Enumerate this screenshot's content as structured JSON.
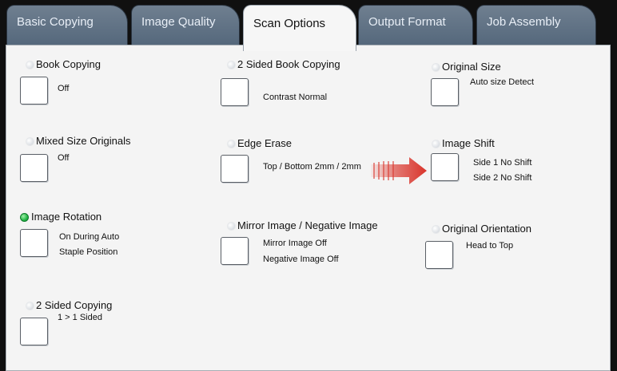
{
  "tabs": [
    {
      "label": "Basic Copying",
      "active": false
    },
    {
      "label": "Image Quality",
      "active": false
    },
    {
      "label": "Scan Options",
      "active": true
    },
    {
      "label": "Output Format",
      "active": false
    },
    {
      "label": "Job Assembly",
      "active": false
    }
  ],
  "options": {
    "book_copying": {
      "title": "Book Copying",
      "values": [
        "Off"
      ],
      "selected": false
    },
    "two_sided_book_copying": {
      "title": "2 Sided Book Copying",
      "values": [
        "Contrast Normal"
      ],
      "selected": false
    },
    "original_size": {
      "title": "Original Size",
      "values": [
        "Auto size Detect"
      ],
      "selected": false
    },
    "mixed_size_originals": {
      "title": "Mixed Size Originals",
      "values": [
        "Off"
      ],
      "selected": false
    },
    "edge_erase": {
      "title": "Edge Erase",
      "values": [
        "Top / Bottom 2mm / 2mm"
      ],
      "selected": false
    },
    "image_shift": {
      "title": "Image Shift",
      "values": [
        "Side 1 No Shift",
        "Side 2 No Shift"
      ],
      "selected": false
    },
    "image_rotation": {
      "title": "Image Rotation",
      "values": [
        "On During Auto",
        "Staple Position"
      ],
      "selected": true
    },
    "mirror_negative": {
      "title": "Mirror Image / Negative Image",
      "values": [
        "Mirror Image Off",
        "Negative Image Off"
      ],
      "selected": false
    },
    "original_orientation": {
      "title": "Original Orientation",
      "values": [
        "Head to Top"
      ],
      "selected": false
    },
    "two_sided_copying": {
      "title": "2 Sided Copying",
      "values": [
        "1 > 1 Sided"
      ],
      "selected": false
    }
  },
  "colors": {
    "accent_arrow": "#d9342b",
    "radio_selected": "#22b545",
    "tab_inactive": "#607184",
    "panel_bg": "#f4f4f4"
  },
  "icons": {
    "pointer_arrow": "red-right-arrow-icon"
  }
}
